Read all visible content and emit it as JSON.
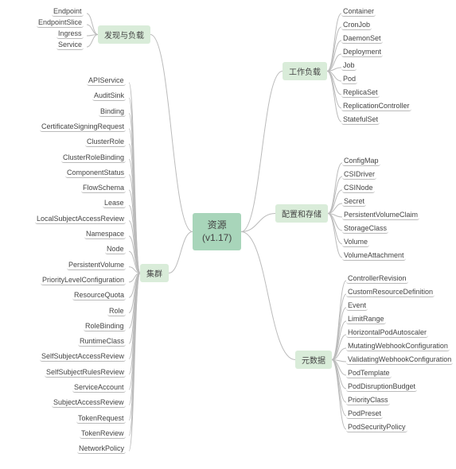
{
  "root": {
    "title": "资源",
    "version": "(v1.17)"
  },
  "branches": {
    "discovery": {
      "label": "发现与负载",
      "items": [
        "Endpoint",
        "EndpointSlice",
        "Ingress",
        "Service"
      ]
    },
    "cluster": {
      "label": "集群",
      "items": [
        "APIService",
        "AuditSink",
        "Binding",
        "CertificateSigningRequest",
        "ClusterRole",
        "ClusterRoleBinding",
        "ComponentStatus",
        "FlowSchema",
        "Lease",
        "LocalSubjectAccessReview",
        "Namespace",
        "Node",
        "PersistentVolume",
        "PriorityLevelConfiguration",
        "ResourceQuota",
        "Role",
        "RoleBinding",
        "RuntimeClass",
        "SelfSubjectAccessReview",
        "SelfSubjectRulesReview",
        "ServiceAccount",
        "SubjectAccessReview",
        "TokenRequest",
        "TokenReview",
        "NetworkPolicy"
      ]
    },
    "workload": {
      "label": "工作负载",
      "items": [
        "Container",
        "CronJob",
        "DaemonSet",
        "Deployment",
        "Job",
        "Pod",
        "ReplicaSet",
        "ReplicationController",
        "StatefulSet"
      ]
    },
    "config": {
      "label": "配置和存储",
      "items": [
        "ConfigMap",
        "CSIDriver",
        "CSINode",
        "Secret",
        "PersistentVolumeClaim",
        "StorageClass",
        "Volume",
        "VolumeAttachment"
      ]
    },
    "metadata": {
      "label": "元数据",
      "items": [
        "ControllerRevision",
        "CustomResourceDefinition",
        "Event",
        "LimitRange",
        "HorizontalPodAutoscaler",
        "MutatingWebhookConfiguration",
        "ValidatingWebhookConfiguration",
        "PodTemplate",
        "PodDisruptionBudget",
        "PriorityClass",
        "PodPreset",
        "PodSecurityPolicy"
      ]
    }
  }
}
